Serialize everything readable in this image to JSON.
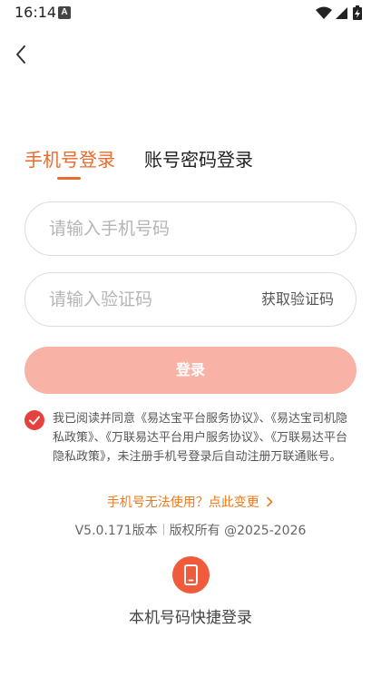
{
  "status_bar": {
    "time": "16:14",
    "notification_letter": "A"
  },
  "tabs": {
    "phone_login": "手机号登录",
    "account_login": "账号密码登录"
  },
  "form": {
    "phone_placeholder": "请输入手机号码",
    "code_placeholder": "请输入验证码",
    "get_code": "获取验证码",
    "login_button": "登录"
  },
  "agreement": {
    "text": "我已阅读并同意《易达宝平台服务协议》、《易达宝司机隐私政策》、《万联易达平台用户服务协议》、《万联易达平台隐私政策》，未注册手机号登录后自动注册万联通账号。",
    "checked": true
  },
  "links": {
    "phone_unavailable": "手机号无法使用？点此变更"
  },
  "footer": {
    "version": "V5.0.171版本",
    "copyright": "版权所有 @2025-2026"
  },
  "quick_login": {
    "label": "本机号码快捷登录"
  },
  "colors": {
    "accent": "#ec6a2c",
    "button_disabled": "#f8b3a6",
    "check_red": "#e5413e",
    "quick_icon": "#ef5b3b"
  }
}
